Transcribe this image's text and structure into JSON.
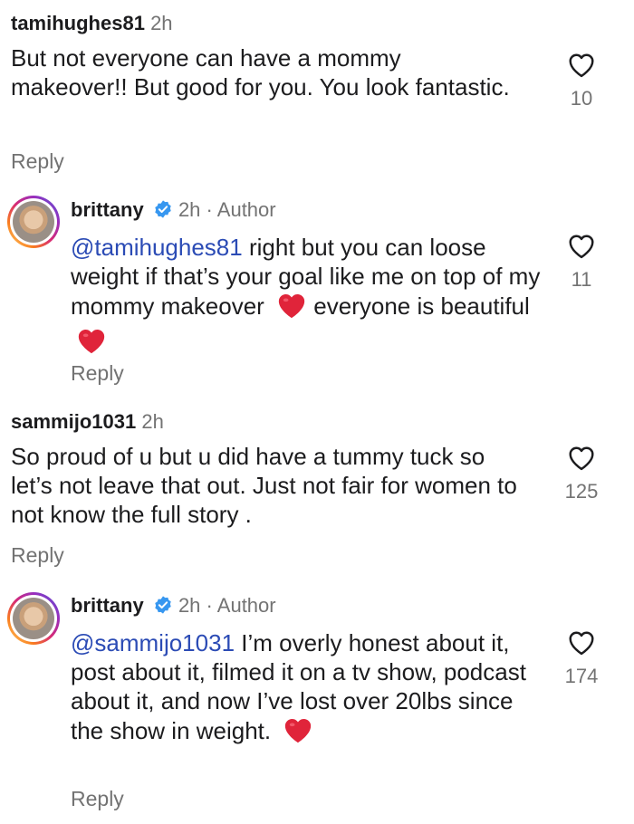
{
  "comments": [
    {
      "username": "tamihughes81",
      "time": "2h",
      "body": "But not everyone can have a mommy makeover!! But good for you. You look fantastic.",
      "likes": "10",
      "reply_label": "Reply"
    },
    {
      "username": "brittany",
      "verified": true,
      "time": "2h",
      "author_label": "Author",
      "mention": "@tamihughes81",
      "body": " right but you can loose weight if that’s your goal like me on top of my mommy makeover",
      "body_end": "everyone is beautiful",
      "likes": "11",
      "reply_label": "Reply"
    },
    {
      "username": "sammijo1031",
      "time": "2h",
      "body": "So proud of u but u did have a tummy tuck so let’s not leave that out. Just not fair for women to not know the full story .",
      "likes": "125",
      "reply_label": "Reply"
    },
    {
      "username": "brittany",
      "verified": true,
      "time": "2h",
      "author_label": "Author",
      "mention": "@sammijo1031",
      "body": " I’m overly honest about it, post about it, filmed it on a tv show, podcast about it, and now I’ve lost over 20lbs since the show in weight.",
      "likes": "174",
      "reply_label": "Reply"
    }
  ],
  "colors": {
    "mention": "#2b4bb5",
    "muted": "#737373",
    "verified": "#3797f0",
    "heart_emoji": "#e0243a"
  },
  "icons": {
    "like": "heart-outline-icon",
    "verified": "verified-badge-icon",
    "emoji": "red-heart-emoji"
  }
}
